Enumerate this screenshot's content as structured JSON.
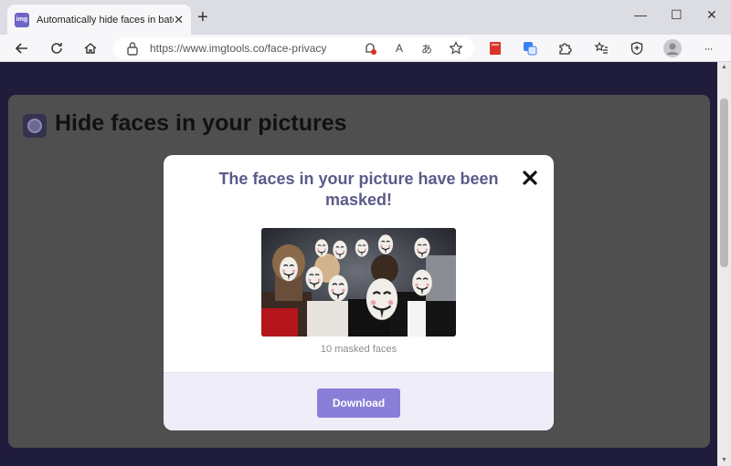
{
  "browser": {
    "tab": {
      "favicon_text": "img",
      "title": "Automatically hide faces in batch",
      "close_glyph": "✕"
    },
    "new_tab_glyph": "+",
    "window_controls": {
      "minimize": "—",
      "maximize": "☐",
      "close": "✕"
    },
    "address": {
      "url": "https://www.imgtools.co/face-privacy",
      "read_aloud_glyph": "A",
      "translate_glyph": "あ"
    },
    "toolbar_icons": [
      "back-arrow-icon",
      "refresh-icon",
      "home-icon",
      "lock-icon",
      "tracking-prevention-icon",
      "read-aloud-icon",
      "translate-icon",
      "favorite-star-icon",
      "collections-red-icon",
      "translate-extension-icon",
      "extensions-puzzle-icon",
      "favorites-list-icon",
      "browser-essentials-icon",
      "profile-avatar-icon",
      "more-menu-icon"
    ],
    "more_glyph": "···"
  },
  "page": {
    "title": "Hide faces in your pictures"
  },
  "modal": {
    "title": "The faces in your picture have been masked!",
    "close_glyph": "✕",
    "caption": "10 masked faces",
    "download_label": "Download"
  },
  "colors": {
    "modal_title": "#5b5a8a",
    "download_button": "#8a7fd8",
    "page_background": "#201c3b",
    "card_background": "#4f4f4f"
  }
}
